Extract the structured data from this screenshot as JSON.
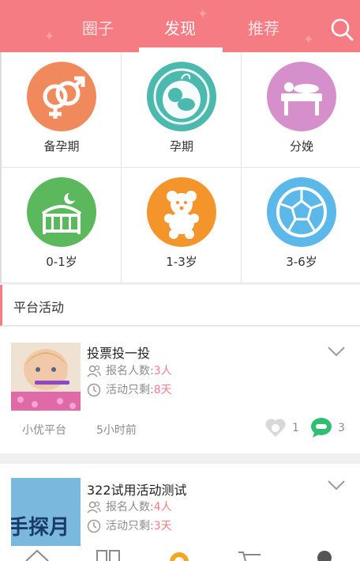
{
  "header": {
    "tabs": [
      {
        "label": "圈子",
        "active": false
      },
      {
        "label": "发现",
        "active": true
      },
      {
        "label": "推荐",
        "active": false
      }
    ],
    "accent_color": "#f67c84"
  },
  "categories": [
    {
      "label": "备孕期",
      "icon": "gender-icon",
      "color": "#f08a5d"
    },
    {
      "label": "孕期",
      "icon": "fetus-icon",
      "color": "#4bb9ae"
    },
    {
      "label": "分娩",
      "icon": "delivery-bed-icon",
      "color": "#d58fcb"
    },
    {
      "label": "0-1岁",
      "icon": "crib-icon",
      "color": "#5cb85c"
    },
    {
      "label": "1-3岁",
      "icon": "teddy-bear-icon",
      "color": "#f3952b"
    },
    {
      "label": "3-6岁",
      "icon": "football-icon",
      "color": "#5bb8e8"
    }
  ],
  "section": {
    "title": "平台活动"
  },
  "activities": [
    {
      "title": "投票投一投",
      "signup_label": "报名人数:",
      "signup_count": "3人",
      "remaining_label": "活动只剩:",
      "remaining_days": "8天",
      "publisher": "小优平台",
      "time_ago": "5小时前",
      "likes": "1",
      "comments": "3"
    },
    {
      "title": "322试用活动测试",
      "signup_label": "报名人数:",
      "signup_count": "4人",
      "remaining_label": "活动只剩:",
      "remaining_days": "3天",
      "thumb_text": "手探月"
    }
  ]
}
